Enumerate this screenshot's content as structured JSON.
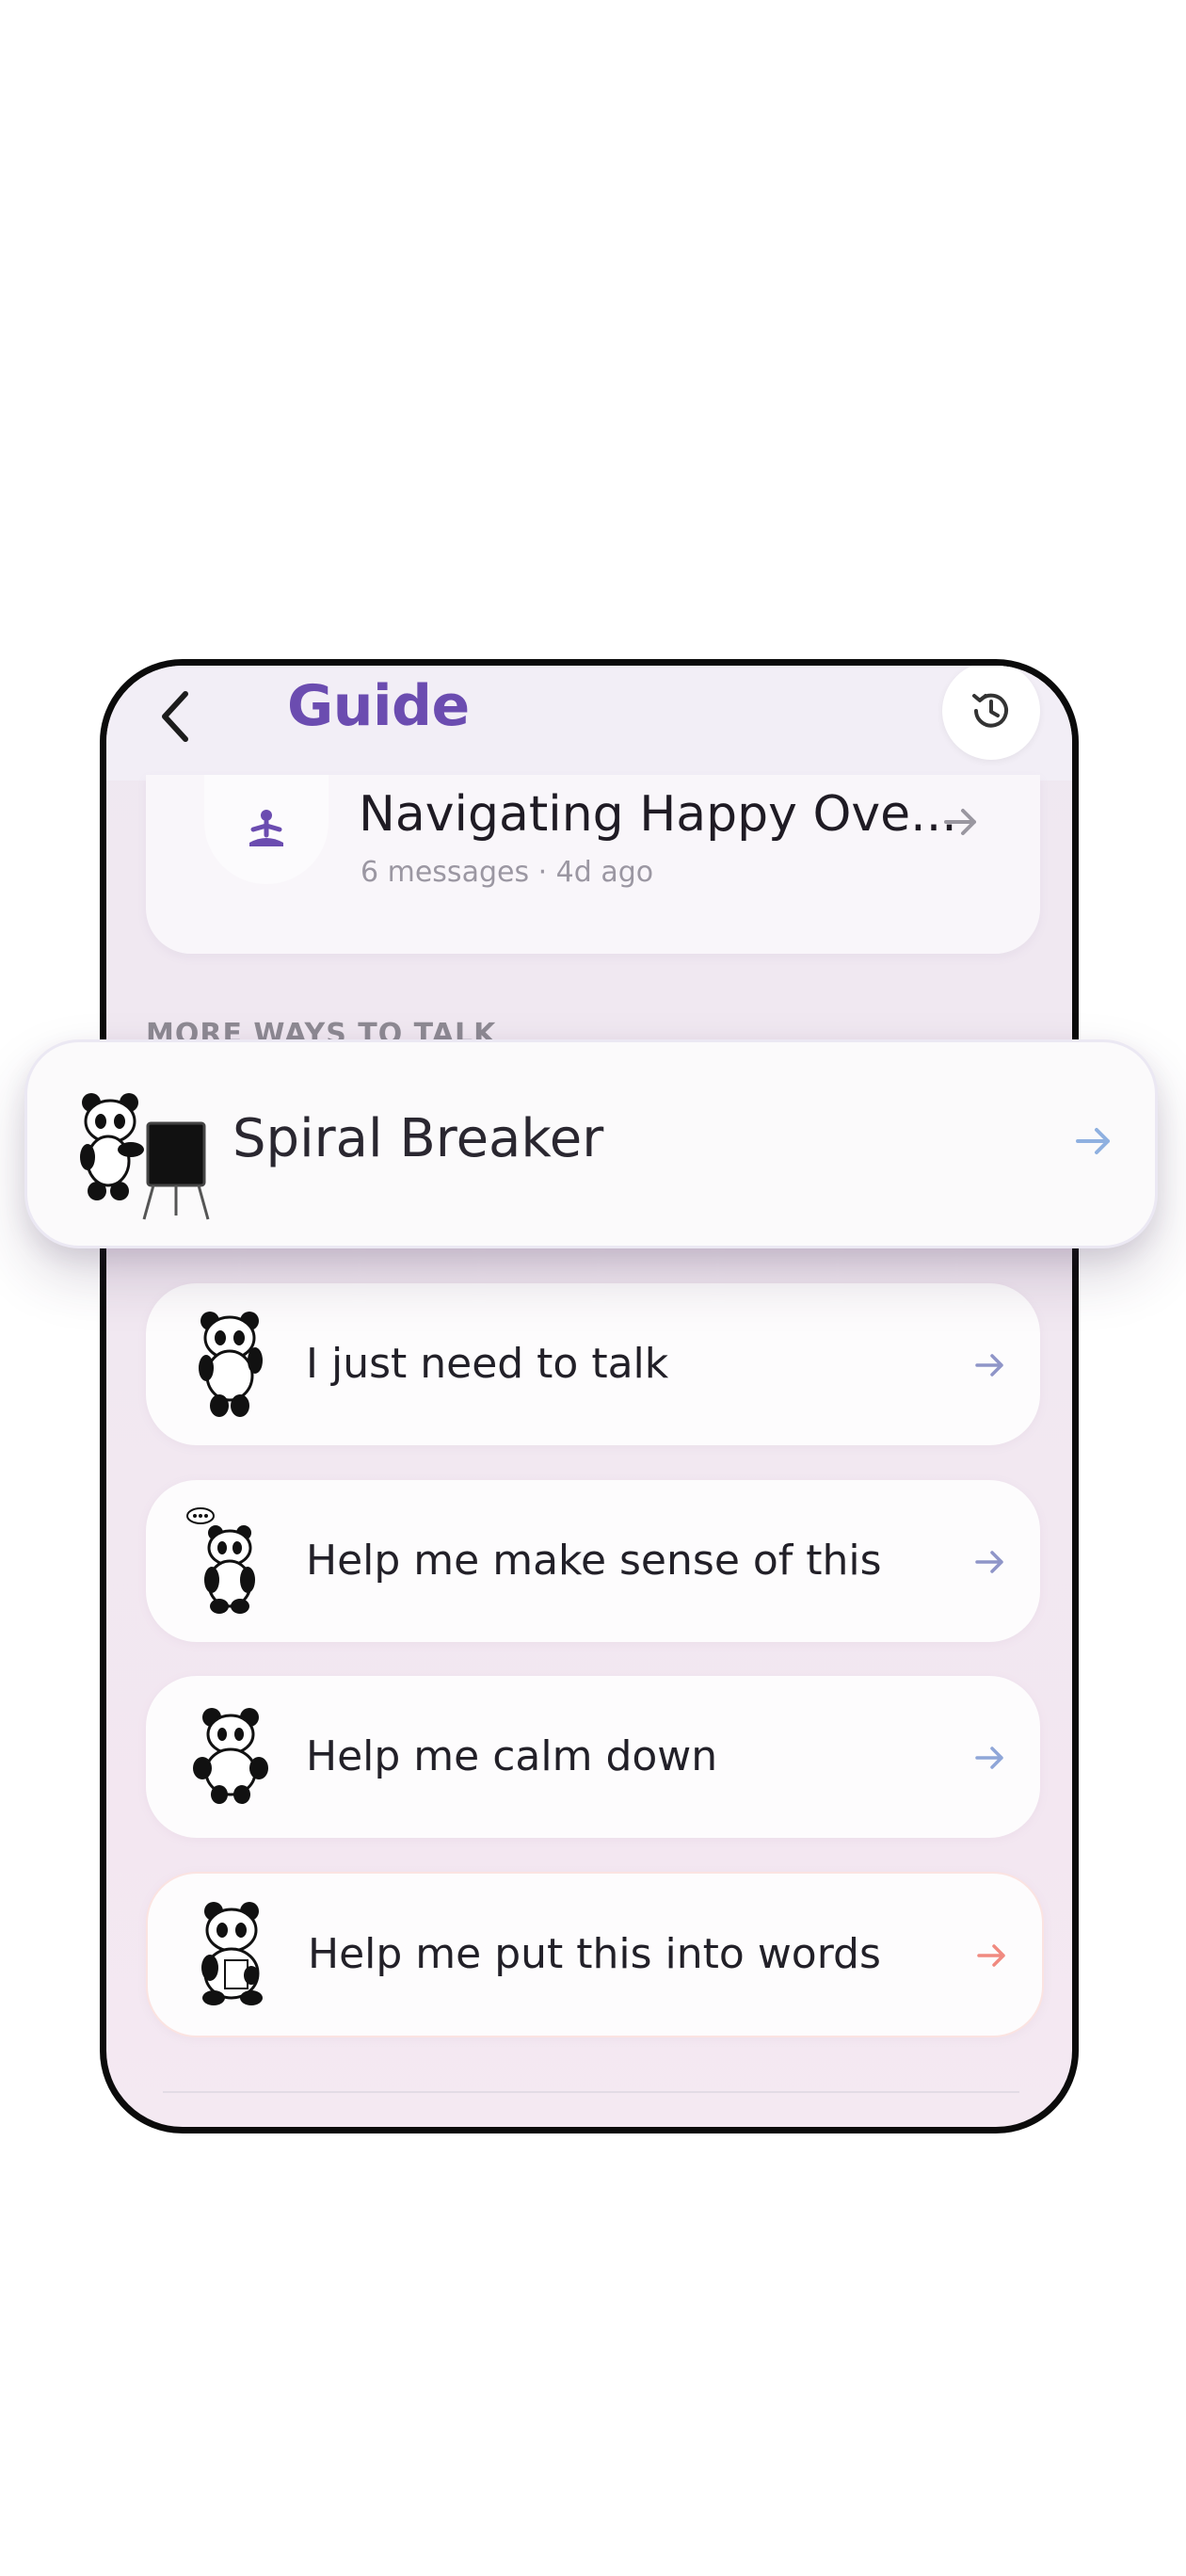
{
  "header": {
    "title": "Guide",
    "back_icon": "chevron-left-icon",
    "history_icon": "history-icon"
  },
  "recent": {
    "icon": "meditation-icon",
    "title": "Navigating Happy Ove...",
    "meta": "6 messages · 4d ago"
  },
  "section": {
    "label": "MORE WAYS TO TALK"
  },
  "featured": {
    "label": "Spiral Breaker",
    "icon": "panda-easel-icon"
  },
  "options": [
    {
      "label": "I just need to talk",
      "icon": "panda-wave-icon",
      "arrow_color": "#8f95c8"
    },
    {
      "label": "Help me make sense of this",
      "icon": "panda-thinking-icon",
      "arrow_color": "#8f95c8"
    },
    {
      "label": "Help me calm down",
      "icon": "panda-calm-icon",
      "arrow_color": "#8fa6d8"
    },
    {
      "label": "Help me put this into words",
      "icon": "panda-writing-icon",
      "arrow_color": "#f08a80"
    }
  ],
  "colors": {
    "accent": "#6b4cb0",
    "featured_arrow": "#8fb0e0"
  }
}
